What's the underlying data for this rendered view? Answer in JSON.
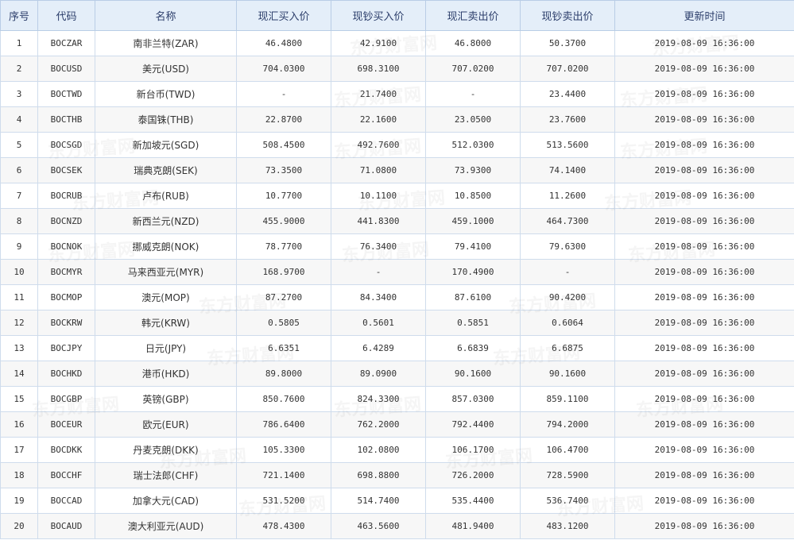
{
  "columns": {
    "index": "序号",
    "code": "代码",
    "name": "名称",
    "spot_buy": "现汇买入价",
    "cash_buy": "现钞买入价",
    "spot_sell": "现汇卖出价",
    "cash_sell": "现钞卖出价",
    "updated": "更新时间"
  },
  "watermark": "东方财富网",
  "rows": [
    {
      "index": "1",
      "code": "BOCZAR",
      "name": "南非兰特(ZAR)",
      "spot_buy": "46.4800",
      "cash_buy": "42.9100",
      "spot_sell": "46.8000",
      "cash_sell": "50.3700",
      "updated": "2019-08-09 16:36:00"
    },
    {
      "index": "2",
      "code": "BOCUSD",
      "name": "美元(USD)",
      "spot_buy": "704.0300",
      "cash_buy": "698.3100",
      "spot_sell": "707.0200",
      "cash_sell": "707.0200",
      "updated": "2019-08-09 16:36:00"
    },
    {
      "index": "3",
      "code": "BOCTWD",
      "name": "新台币(TWD)",
      "spot_buy": "-",
      "cash_buy": "21.7400",
      "spot_sell": "-",
      "cash_sell": "23.4400",
      "updated": "2019-08-09 16:36:00"
    },
    {
      "index": "4",
      "code": "BOCTHB",
      "name": "泰国铢(THB)",
      "spot_buy": "22.8700",
      "cash_buy": "22.1600",
      "spot_sell": "23.0500",
      "cash_sell": "23.7600",
      "updated": "2019-08-09 16:36:00"
    },
    {
      "index": "5",
      "code": "BOCSGD",
      "name": "新加坡元(SGD)",
      "spot_buy": "508.4500",
      "cash_buy": "492.7600",
      "spot_sell": "512.0300",
      "cash_sell": "513.5600",
      "updated": "2019-08-09 16:36:00"
    },
    {
      "index": "6",
      "code": "BOCSEK",
      "name": "瑞典克朗(SEK)",
      "spot_buy": "73.3500",
      "cash_buy": "71.0800",
      "spot_sell": "73.9300",
      "cash_sell": "74.1400",
      "updated": "2019-08-09 16:36:00"
    },
    {
      "index": "7",
      "code": "BOCRUB",
      "name": "卢布(RUB)",
      "spot_buy": "10.7700",
      "cash_buy": "10.1100",
      "spot_sell": "10.8500",
      "cash_sell": "11.2600",
      "updated": "2019-08-09 16:36:00"
    },
    {
      "index": "8",
      "code": "BOCNZD",
      "name": "新西兰元(NZD)",
      "spot_buy": "455.9000",
      "cash_buy": "441.8300",
      "spot_sell": "459.1000",
      "cash_sell": "464.7300",
      "updated": "2019-08-09 16:36:00"
    },
    {
      "index": "9",
      "code": "BOCNOK",
      "name": "挪威克朗(NOK)",
      "spot_buy": "78.7700",
      "cash_buy": "76.3400",
      "spot_sell": "79.4100",
      "cash_sell": "79.6300",
      "updated": "2019-08-09 16:36:00"
    },
    {
      "index": "10",
      "code": "BOCMYR",
      "name": "马来西亚元(MYR)",
      "spot_buy": "168.9700",
      "cash_buy": "-",
      "spot_sell": "170.4900",
      "cash_sell": "-",
      "updated": "2019-08-09 16:36:00"
    },
    {
      "index": "11",
      "code": "BOCMOP",
      "name": "澳元(MOP)",
      "spot_buy": "87.2700",
      "cash_buy": "84.3400",
      "spot_sell": "87.6100",
      "cash_sell": "90.4200",
      "updated": "2019-08-09 16:36:00"
    },
    {
      "index": "12",
      "code": "BOCKRW",
      "name": "韩元(KRW)",
      "spot_buy": "0.5805",
      "cash_buy": "0.5601",
      "spot_sell": "0.5851",
      "cash_sell": "0.6064",
      "updated": "2019-08-09 16:36:00"
    },
    {
      "index": "13",
      "code": "BOCJPY",
      "name": "日元(JPY)",
      "spot_buy": "6.6351",
      "cash_buy": "6.4289",
      "spot_sell": "6.6839",
      "cash_sell": "6.6875",
      "updated": "2019-08-09 16:36:00"
    },
    {
      "index": "14",
      "code": "BOCHKD",
      "name": "港币(HKD)",
      "spot_buy": "89.8000",
      "cash_buy": "89.0900",
      "spot_sell": "90.1600",
      "cash_sell": "90.1600",
      "updated": "2019-08-09 16:36:00"
    },
    {
      "index": "15",
      "code": "BOCGBP",
      "name": "英镑(GBP)",
      "spot_buy": "850.7600",
      "cash_buy": "824.3300",
      "spot_sell": "857.0300",
      "cash_sell": "859.1100",
      "updated": "2019-08-09 16:36:00"
    },
    {
      "index": "16",
      "code": "BOCEUR",
      "name": "欧元(EUR)",
      "spot_buy": "786.6400",
      "cash_buy": "762.2000",
      "spot_sell": "792.4400",
      "cash_sell": "794.2000",
      "updated": "2019-08-09 16:36:00"
    },
    {
      "index": "17",
      "code": "BOCDKK",
      "name": "丹麦克朗(DKK)",
      "spot_buy": "105.3300",
      "cash_buy": "102.0800",
      "spot_sell": "106.1700",
      "cash_sell": "106.4700",
      "updated": "2019-08-09 16:36:00"
    },
    {
      "index": "18",
      "code": "BOCCHF",
      "name": "瑞士法郎(CHF)",
      "spot_buy": "721.1400",
      "cash_buy": "698.8800",
      "spot_sell": "726.2000",
      "cash_sell": "728.5900",
      "updated": "2019-08-09 16:36:00"
    },
    {
      "index": "19",
      "code": "BOCCAD",
      "name": "加拿大元(CAD)",
      "spot_buy": "531.5200",
      "cash_buy": "514.7400",
      "spot_sell": "535.4400",
      "cash_sell": "536.7400",
      "updated": "2019-08-09 16:36:00"
    },
    {
      "index": "20",
      "code": "BOCAUD",
      "name": "澳大利亚元(AUD)",
      "spot_buy": "478.4300",
      "cash_buy": "463.5600",
      "spot_sell": "481.9400",
      "cash_sell": "483.1200",
      "updated": "2019-08-09 16:36:00"
    }
  ]
}
